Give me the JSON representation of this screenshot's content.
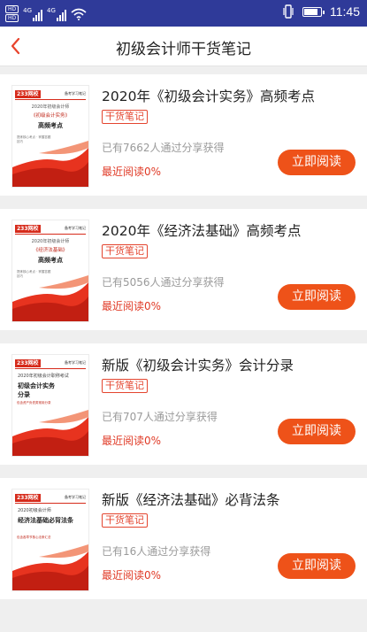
{
  "status_bar": {
    "sim1": "HD",
    "sim2": "HD",
    "net1": "4G",
    "net2": "4G",
    "time": "11:45",
    "battery_level": 0.9,
    "icons": [
      "signal-icon",
      "wifi-icon",
      "vibrate-icon",
      "battery-icon"
    ]
  },
  "header": {
    "title": "初级会计师干货笔记",
    "back_icon": "chevron-left-icon"
  },
  "colors": {
    "status_bar": "#2f3a99",
    "accent": "#ee5219",
    "tag": "#e4452f",
    "progress_text": "#e03a26"
  },
  "books": [
    {
      "title": "2020年《初级会计实务》高频考点",
      "tag": "干货笔记",
      "readers": "已有7662人通过分享获得",
      "progress": "最近阅读0%",
      "button": "立即阅读",
      "cover": {
        "logo": "233网校",
        "series": "备考学习笔记",
        "line1": "2020年初级会计师",
        "line2": "《初级会计实务》",
        "line3": "高频考点",
        "small": "提炼核心考点 · 掌握答题技巧"
      }
    },
    {
      "title": "2020年《经济法基础》高频考点",
      "tag": "干货笔记",
      "readers": "已有5056人通过分享获得",
      "progress": "最近阅读0%",
      "button": "立即阅读",
      "cover": {
        "logo": "233网校",
        "series": "备考学习笔记",
        "line1": "2020年初级会计师",
        "line2": "《经济法基础》",
        "line3": "高频考点",
        "small": "提炼核心考点 · 掌握答题技巧"
      }
    },
    {
      "title": "新版《初级会计实务》会计分录",
      "tag": "干货笔记",
      "readers": "已有707人通过分享获得",
      "progress": "最近阅读0%",
      "button": "立即阅读",
      "cover": {
        "logo": "233网校",
        "series": "备考学习笔记",
        "line1": "2020年初级会计职称考试",
        "line2": "初级会计实务",
        "line3": "分录",
        "small": "包含资产负债类常用分录"
      }
    },
    {
      "title": "新版《经济法基础》必背法条",
      "tag": "干货笔记",
      "readers": "已有16人通过分享获得",
      "progress": "最近阅读0%",
      "button": "立即阅读",
      "cover": {
        "logo": "233网校",
        "series": "备考学习笔记",
        "line1": "2020初级会计师",
        "line2": "经济法基础必背法条",
        "line3": "",
        "small": "包含各章节核心法条汇总"
      }
    }
  ]
}
